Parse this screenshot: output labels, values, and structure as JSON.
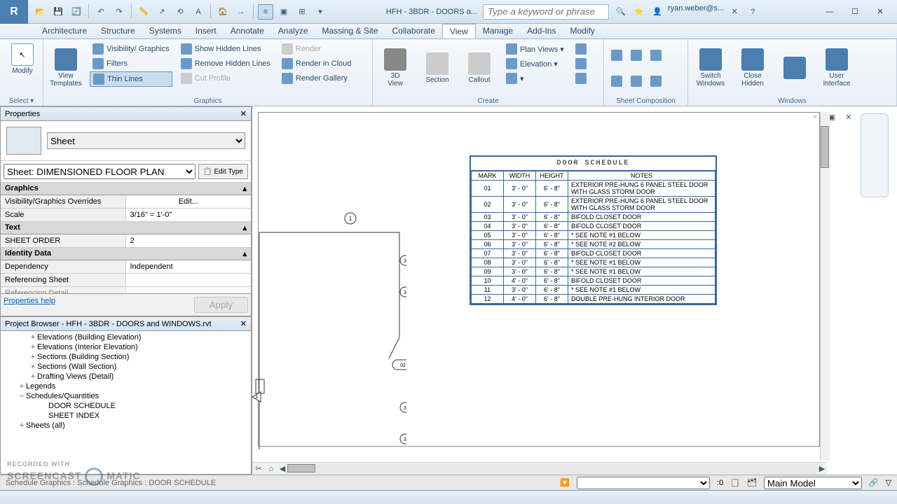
{
  "title_filename": "HFH - 3BDR - DOORS a...",
  "search_placeholder": "Type a keyword or phrase",
  "user_name": "ryan.weber@s...",
  "menu": [
    "Architecture",
    "Structure",
    "Systems",
    "Insert",
    "Annotate",
    "Analyze",
    "Massing & Site",
    "Collaborate",
    "View",
    "Manage",
    "Add-Ins",
    "Modify"
  ],
  "active_menu": "View",
  "ribbon": {
    "modify": "Modify",
    "select": "Select ▾",
    "view_templates": "View\nTemplates",
    "visibility_graphics": "Visibility/ Graphics",
    "filters": "Filters",
    "thin_lines": "Thin Lines",
    "show_hidden": "Show Hidden Lines",
    "remove_hidden": "Remove Hidden Lines",
    "cut_profile": "Cut Profile",
    "render": "Render",
    "render_cloud": "Render in Cloud",
    "render_gallery": "Render Gallery",
    "group_graphics": "Graphics",
    "view3d": "3D\nView",
    "section": "Section",
    "callout": "Callout",
    "plan_views": "Plan Views ▾",
    "elevation": "Elevation ▾",
    "group_create": "Create",
    "group_sheet": "Sheet Composition",
    "switch_windows": "Switch\nWindows",
    "close_hidden": "Close\nHidden",
    "user_interface": "User\nInterface",
    "group_windows": "Windows"
  },
  "properties": {
    "title": "Properties",
    "type_name": "Sheet",
    "instance_dd": "Sheet: DIMENSIONED FLOOR PLAN",
    "edit_type": "Edit Type",
    "cat_graphics": "Graphics",
    "vg_overrides_k": "Visibility/Graphics Overrides",
    "vg_overrides_v": "Edit...",
    "scale_k": "Scale",
    "scale_v": "3/16\" = 1'-0\"",
    "cat_text": "Text",
    "sheet_order_k": "SHEET ORDER",
    "sheet_order_v": "2",
    "cat_identity": "Identity Data",
    "dependency_k": "Dependency",
    "dependency_v": "Independent",
    "ref_sheet_k": "Referencing Sheet",
    "ref_sheet_v": "",
    "ref_detail_k": "Referencing Detail",
    "help": "Properties help",
    "apply": "Apply"
  },
  "browser": {
    "title": "Project Browser - HFH - 3BDR - DOORS and WINDOWS.rvt",
    "items": [
      {
        "indent": 2,
        "exp": "+",
        "label": "Elevations (Building Elevation)"
      },
      {
        "indent": 2,
        "exp": "+",
        "label": "Elevations (Interior Elevation)"
      },
      {
        "indent": 2,
        "exp": "+",
        "label": "Sections (Building Section)"
      },
      {
        "indent": 2,
        "exp": "+",
        "label": "Sections (Wall Section)"
      },
      {
        "indent": 2,
        "exp": "+",
        "label": "Drafting Views (Detail)"
      },
      {
        "indent": 1,
        "exp": "+",
        "label": "Legends"
      },
      {
        "indent": 1,
        "exp": "−",
        "label": "Schedules/Quantities"
      },
      {
        "indent": 3,
        "exp": "",
        "label": "DOOR SCHEDULE"
      },
      {
        "indent": 3,
        "exp": "",
        "label": "SHEET INDEX"
      },
      {
        "indent": 1,
        "exp": "+",
        "label": "Sheets (all)"
      }
    ]
  },
  "schedule": {
    "title": "DOOR SCHEDULE",
    "headers": [
      "MARK",
      "WIDTH",
      "HEIGHT",
      "NOTES"
    ],
    "rows": [
      [
        "01",
        "3' - 0\"",
        "6' - 8\"",
        "EXTERIOR PRE-HUNG 6 PANEL STEEL DOOR WITH GLASS STORM DOOR"
      ],
      [
        "02",
        "3' - 0\"",
        "6' - 8\"",
        "EXTERIOR PRE-HUNG 6 PANEL STEEL DOOR WITH GLASS STORM DOOR"
      ],
      [
        "03",
        "3' - 0\"",
        "6' - 8\"",
        "BIFOLD CLOSET DOOR"
      ],
      [
        "04",
        "3' - 0\"",
        "6' - 8\"",
        "BIFOLD CLOSET DOOR"
      ],
      [
        "05",
        "3' - 0\"",
        "6' - 8\"",
        "* SEE NOTE #1 BELOW"
      ],
      [
        "06",
        "3' - 0\"",
        "6' - 8\"",
        "* SEE NOTE #2 BELOW"
      ],
      [
        "07",
        "3' - 0\"",
        "6' - 8\"",
        "BIFOLD CLOSET DOOR"
      ],
      [
        "08",
        "3' - 0\"",
        "6' - 8\"",
        "* SEE NOTE #1 BELOW"
      ],
      [
        "09",
        "3' - 0\"",
        "6' - 8\"",
        "* SEE NOTE #1 BELOW"
      ],
      [
        "10",
        "4' - 0\"",
        "6' - 8\"",
        "BIFOLD CLOSET DOOR"
      ],
      [
        "11",
        "3' - 0\"",
        "6' - 8\"",
        "* SEE NOTE #1 BELOW"
      ],
      [
        "12",
        "4' - 0\"",
        "6' - 8\"",
        "DOUBLE PRE-HUNG INTERIOR DOOR"
      ]
    ]
  },
  "status_text": "Schedule Graphics : Schedule Graphics : DOOR SCHEDULE",
  "status_zoom": ":0",
  "status_model": "Main Model",
  "watermark1": "RECORDED WITH",
  "watermark2": "SCREENCAST",
  "watermark3": "MATIC"
}
